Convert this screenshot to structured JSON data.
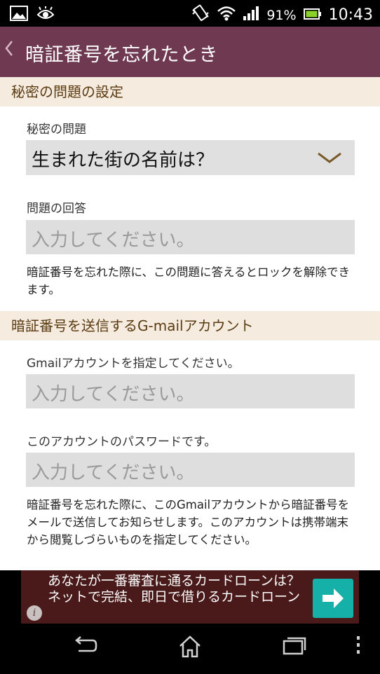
{
  "status_bar": {
    "battery_percent": "91%",
    "time": "10:43"
  },
  "app_bar": {
    "title": "暗証番号を忘れたとき"
  },
  "section1": {
    "header": "秘密の問題の設定",
    "question_label": "秘密の問題",
    "question_value": "生まれた街の名前は？",
    "answer_label": "問題の回答",
    "answer_placeholder": "入力してください。",
    "description": "暗証番号を忘れた際に、この問題に答えるとロックを解除できます。"
  },
  "section2": {
    "header": "暗証番号を送信するG-mailアカウント",
    "gmail_label": "Gmailアカウントを指定してください。",
    "gmail_placeholder": "入力してください。",
    "password_label": "このアカウントのパスワードです。",
    "password_placeholder": "入力してください。",
    "description": "暗証番号を忘れた際に、このGmailアカウントから暗証番号をメールで送信してお知らせします。このアカウントは携帯端末から閲覧しづらいものを指定してください。"
  },
  "ad": {
    "text": "あなたが一番審査に通るカードローンは？ ネットで完結、即日で借りるカードローン",
    "info_glyph": "i"
  },
  "icons": [
    "image-icon",
    "eye-icon",
    "vibrate-icon",
    "wifi-icon",
    "signal-icon",
    "battery-icon",
    "back-chevron-icon",
    "chevron-down-icon",
    "arrow-right-icon",
    "nav-back-icon",
    "nav-home-icon",
    "nav-recents-icon",
    "overflow-menu-icon"
  ]
}
